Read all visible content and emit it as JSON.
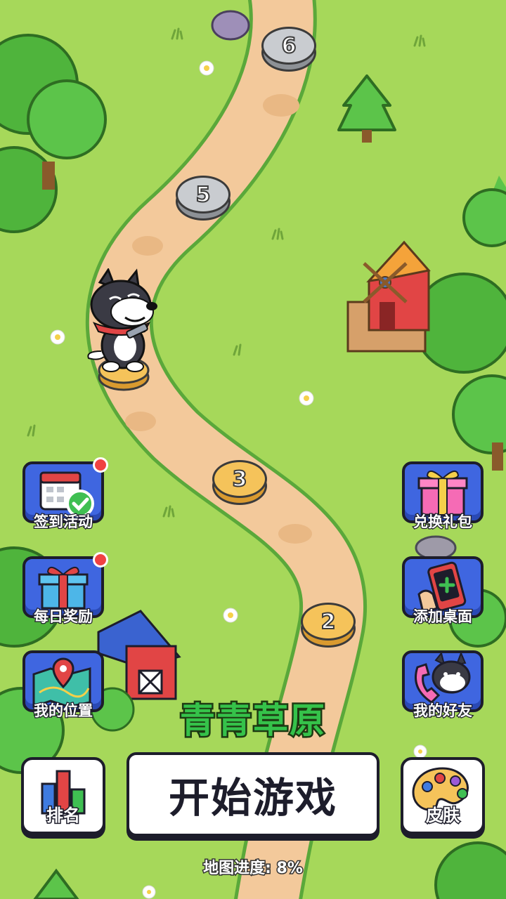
{
  "map": {
    "title": "青青草原",
    "progress_label": "地图进度: 8%",
    "progress_value": 0.08
  },
  "levels": [
    {
      "number": "6",
      "state": "locked"
    },
    {
      "number": "5",
      "state": "locked"
    },
    {
      "number": "3",
      "state": "unlocked"
    },
    {
      "number": "2",
      "state": "unlocked"
    }
  ],
  "left_menu": [
    {
      "label": "签到活动",
      "icon": "calendar-check-icon",
      "has_notification": true
    },
    {
      "label": "每日奖励",
      "icon": "gift-box-icon",
      "has_notification": true
    },
    {
      "label": "我的位置",
      "icon": "map-pin-icon",
      "has_notification": false
    }
  ],
  "right_menu": [
    {
      "label": "兑换礼包",
      "icon": "gift-pack-icon"
    },
    {
      "label": "添加桌面",
      "icon": "phone-add-icon"
    },
    {
      "label": "我的好友",
      "icon": "friend-phone-icon"
    }
  ],
  "bottom_bar": {
    "rank_label": "排名",
    "start_label": "开始游戏",
    "skin_label": "皮肤"
  },
  "colors": {
    "grass": "#a6d85a",
    "path": "#f3c99b",
    "tile_blue": "#3f66e0",
    "title_green": "#35c24a",
    "notify_red": "#f04242"
  }
}
